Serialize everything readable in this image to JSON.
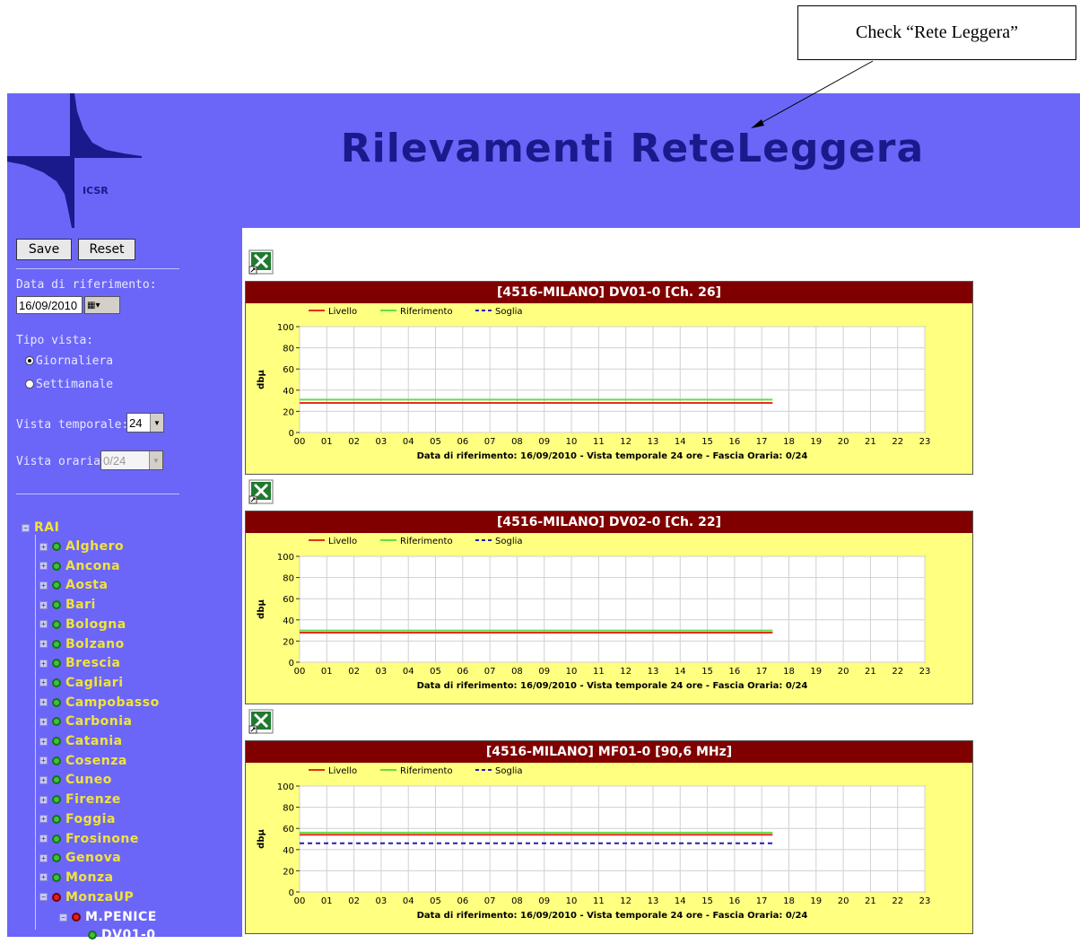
{
  "annotation": {
    "text": "Check “Rete Leggera”"
  },
  "header": {
    "title": "Rilevamenti ReteLeggera",
    "logo_text": "ICSR",
    "bg_color": "#6b66f8",
    "title_color": "#1a1a8c"
  },
  "sidebar": {
    "save_label": "Save",
    "reset_label": "Reset",
    "date_label": "Data di riferimento:",
    "date_value": "16/09/2010",
    "view_type_label": "Tipo vista:",
    "view_options": [
      {
        "label": "Giornaliera",
        "selected": true
      },
      {
        "label": "Settimanale",
        "selected": false
      }
    ],
    "time_view_label": "Vista temporale:",
    "time_view_value": "24",
    "hour_view_label": "Vista oraria:",
    "hour_view_value": "0/24",
    "tree": {
      "root": "RAI",
      "items": [
        {
          "label": "Alghero",
          "status": "green"
        },
        {
          "label": "Ancona",
          "status": "green"
        },
        {
          "label": "Aosta",
          "status": "green"
        },
        {
          "label": "Bari",
          "status": "green"
        },
        {
          "label": "Bologna",
          "status": "green"
        },
        {
          "label": "Bolzano",
          "status": "green"
        },
        {
          "label": "Brescia",
          "status": "green"
        },
        {
          "label": "Cagliari",
          "status": "green"
        },
        {
          "label": "Campobasso",
          "status": "green"
        },
        {
          "label": "Carbonia",
          "status": "green"
        },
        {
          "label": "Catania",
          "status": "green"
        },
        {
          "label": "Cosenza",
          "status": "green"
        },
        {
          "label": "Cuneo",
          "status": "green"
        },
        {
          "label": "Firenze",
          "status": "green"
        },
        {
          "label": "Foggia",
          "status": "green"
        },
        {
          "label": "Frosinone",
          "status": "green"
        },
        {
          "label": "Genova",
          "status": "green"
        },
        {
          "label": "Monza",
          "status": "green"
        },
        {
          "label": "MonzaUP",
          "status": "red"
        }
      ],
      "sub_item": {
        "label": "M.PENICE",
        "status": "red"
      },
      "sub_sub_item": {
        "label": "DV01-0",
        "status": "green"
      }
    }
  },
  "chart_data": [
    {
      "type": "line",
      "title": "[4516-MILANO] DV01-0 [Ch. 26]",
      "ylabel": "dbμ",
      "xlabel": "Data di riferimento: 16/09/2010 - Vista temporale 24 ore - Fascia Oraria: 0/24",
      "x": [
        "00",
        "01",
        "02",
        "03",
        "04",
        "05",
        "06",
        "07",
        "08",
        "09",
        "10",
        "11",
        "12",
        "13",
        "14",
        "15",
        "16",
        "17",
        "18",
        "19",
        "20",
        "21",
        "22",
        "23"
      ],
      "ylim": [
        0,
        100
      ],
      "yticks": [
        0,
        20,
        40,
        60,
        80,
        100
      ],
      "legend": [
        "Livello",
        "Riferimento",
        "Soglia"
      ],
      "series": [
        {
          "name": "Livello",
          "color": "#e03020",
          "dash": false,
          "value": 28,
          "x_end": 17.4
        },
        {
          "name": "Riferimento",
          "color": "#66dd44",
          "dash": false,
          "value": 31,
          "x_end": 17.4
        },
        {
          "name": "Soglia",
          "color": "#2020b0",
          "dash": true,
          "value": null,
          "x_end": 17.4
        }
      ]
    },
    {
      "type": "line",
      "title": "[4516-MILANO] DV02-0 [Ch. 22]",
      "ylabel": "dbμ",
      "xlabel": "Data di riferimento: 16/09/2010 - Vista temporale 24 ore - Fascia Oraria: 0/24",
      "x": [
        "00",
        "01",
        "02",
        "03",
        "04",
        "05",
        "06",
        "07",
        "08",
        "09",
        "10",
        "11",
        "12",
        "13",
        "14",
        "15",
        "16",
        "17",
        "18",
        "19",
        "20",
        "21",
        "22",
        "23"
      ],
      "ylim": [
        0,
        100
      ],
      "yticks": [
        0,
        20,
        40,
        60,
        80,
        100
      ],
      "legend": [
        "Livello",
        "Riferimento",
        "Soglia"
      ],
      "series": [
        {
          "name": "Livello",
          "color": "#e03020",
          "dash": false,
          "value": 28,
          "x_end": 17.4
        },
        {
          "name": "Riferimento",
          "color": "#66dd44",
          "dash": false,
          "value": 30,
          "x_end": 17.4
        },
        {
          "name": "Soglia",
          "color": "#2020b0",
          "dash": true,
          "value": null,
          "x_end": 17.4
        }
      ]
    },
    {
      "type": "line",
      "title": "[4516-MILANO] MF01-0 [90,6 MHz]",
      "ylabel": "dbμ",
      "xlabel": "Data di riferimento: 16/09/2010 - Vista temporale 24 ore - Fascia Oraria: 0/24",
      "x": [
        "00",
        "01",
        "02",
        "03",
        "04",
        "05",
        "06",
        "07",
        "08",
        "09",
        "10",
        "11",
        "12",
        "13",
        "14",
        "15",
        "16",
        "17",
        "18",
        "19",
        "20",
        "21",
        "22",
        "23"
      ],
      "ylim": [
        0,
        100
      ],
      "yticks": [
        0,
        20,
        40,
        60,
        80,
        100
      ],
      "legend": [
        "Livello",
        "Riferimento",
        "Soglia"
      ],
      "series": [
        {
          "name": "Livello",
          "color": "#e03020",
          "dash": false,
          "value": 54,
          "x_end": 17.4
        },
        {
          "name": "Riferimento",
          "color": "#66dd44",
          "dash": false,
          "value": 56,
          "x_end": 17.4
        },
        {
          "name": "Soglia",
          "color": "#2020b0",
          "dash": true,
          "value": 46,
          "x_end": 17.4
        }
      ]
    }
  ]
}
